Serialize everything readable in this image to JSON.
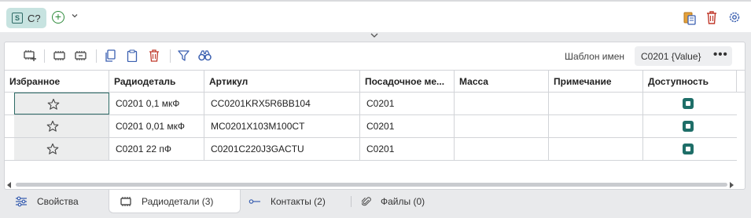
{
  "header": {
    "chip_badge": "S",
    "chip_label": "С?",
    "add_icon": "plus-circle-icon",
    "add_dropdown_icon": "chevron-down-icon",
    "right_icons": [
      "clipboard-paste-icon",
      "trash-icon",
      "gear-icon"
    ]
  },
  "toolbar": {
    "icons": [
      "add-component-icon",
      "component-icon",
      "component-edit-icon",
      "copy-icon",
      "paste-icon",
      "delete-icon",
      "filter-icon",
      "find-icon"
    ],
    "template_label": "Шаблон имен",
    "template_value": "C0201 {Value}",
    "more_label": "•••"
  },
  "table": {
    "columns": [
      "Избранное",
      "Радиодеталь",
      "Артикул",
      "Посадочное ме...",
      "Масса",
      "Примечание",
      "Доступность"
    ],
    "rows": [
      {
        "part": "C0201 0,1 мкФ",
        "article": "CC0201KRX5R6BB104",
        "footprint": "C0201",
        "mass": "",
        "note": ""
      },
      {
        "part": "C0201 0,01 мкФ",
        "article": "MC0201X103M100CT",
        "footprint": "C0201",
        "mass": "",
        "note": ""
      },
      {
        "part": "C0201 22 пФ",
        "article": "C0201C220J3GACTU",
        "footprint": "C0201",
        "mass": "",
        "note": ""
      }
    ]
  },
  "tabs": [
    {
      "label": "Свойства",
      "icon": "sliders-icon"
    },
    {
      "label": "Радиодетали (3)",
      "icon": "chip-icon"
    },
    {
      "label": "Контакты (2)",
      "icon": "pin-icon"
    },
    {
      "label": "Файлы (0)",
      "icon": "paperclip-icon"
    }
  ],
  "colors": {
    "accent": "#1e6e68",
    "chip_bg": "#c7e3e0",
    "delete": "#c0392b",
    "link": "#3a5fb0"
  }
}
